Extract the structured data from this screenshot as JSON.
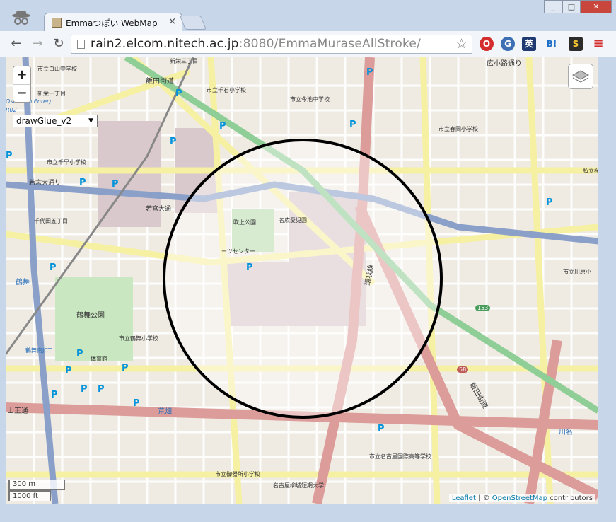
{
  "window": {
    "tab_title": "Emmaつぽい WebMap",
    "tab_close": "×",
    "min": "_",
    "max": "□",
    "close": "✕"
  },
  "toolbar": {
    "back": "←",
    "forward": "→",
    "reload": "↻",
    "url_host": "rain2.elcom.nitech.ac.jp",
    "url_rest": ":8080/EmmaMuraseAllStroke/",
    "star": "☆",
    "ext_b": "B!",
    "ext_eng": "英",
    "ext_s": "S",
    "menu": "≡"
  },
  "map": {
    "zoom_in": "+",
    "zoom_out": "−",
    "draw_mode": "drawGlue_v2",
    "draw_mode_arrow": "▼",
    "scale_m": "300 m",
    "scale_ft": "1000 ft",
    "attrib_leaflet": "Leaflet",
    "attrib_sep": " | © ",
    "attrib_osm": "OpenStreetMap",
    "attrib_contrib": " contributors",
    "labels": [
      {
        "text": "市立白山中学校"
      },
      {
        "text": "新栄三丁目"
      },
      {
        "text": "新栄一丁目"
      },
      {
        "text": "飯田街道"
      },
      {
        "text": "市立千石小学校"
      },
      {
        "text": "市立今池中学校"
      },
      {
        "text": "広小路通り"
      },
      {
        "text": "市立春岡小学校"
      },
      {
        "text": "市立千早小学校"
      },
      {
        "text": "若宮大通り"
      },
      {
        "text": "若宮大通"
      },
      {
        "text": "千代田五丁目"
      },
      {
        "text": "鶴舞"
      },
      {
        "text": "鶴舞公園"
      },
      {
        "text": "市立鶴舞小学校"
      },
      {
        "text": "鶴舞南JCT"
      },
      {
        "text": "体育館"
      },
      {
        "text": "山王通"
      },
      {
        "text": "荒畑"
      },
      {
        "text": "市立御器所小学校"
      },
      {
        "text": "名古屋柳城短期大学"
      },
      {
        "text": "市立名古屋国際高等学校"
      },
      {
        "text": "環状線"
      },
      {
        "text": "飯田街道"
      },
      {
        "text": "市立川原小"
      },
      {
        "text": "私立桜"
      },
      {
        "text": "川名"
      },
      {
        "text": "吹上公園"
      },
      {
        "text": "名広愛児園"
      },
      {
        "text": "ーツセンター"
      },
      {
        "text": "Oshincho Enter)"
      },
      {
        "text": "R02"
      },
      {
        "text": "153"
      },
      {
        "text": "58"
      }
    ],
    "parking": "P"
  }
}
